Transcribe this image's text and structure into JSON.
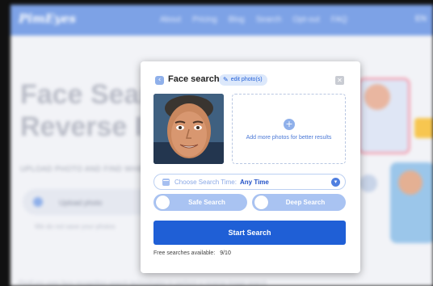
{
  "background": {
    "logo": "PimEyes",
    "nav_links": [
      "About",
      "Pricing",
      "Blog",
      "Search",
      "Opt-out",
      "FAQ"
    ],
    "nav_right": "EN",
    "hero_line1": "Face Search",
    "hero_line2": "Reverse Image",
    "subtitle": "UPLOAD PHOTO AND FIND WHERE IMAGES ARE PUBLISHED",
    "input_text": "Upload photo",
    "note": "We do not save your photos",
    "bottom_text": "PimEyes uses face recognition search technologies to perform a reverse image search"
  },
  "modal": {
    "title": "Face search",
    "edit_chip_label": "edit photo(s)",
    "add_more_text": "Add more photos for better results",
    "time_select": {
      "label": "Choose Search Time:",
      "value": "Any Time"
    },
    "toggles": {
      "safe": {
        "label": "Safe Search",
        "on": false
      },
      "deep": {
        "label": "Deep Search",
        "on": false
      }
    },
    "start_button": "Start Search",
    "free_label": "Free searches available:",
    "free_count": "9/10"
  },
  "colors": {
    "primary": "#1f5fd6",
    "accent_light": "#a9c3f2",
    "nav_blue": "#7da2e6"
  },
  "icons": {
    "back": "arrow-left-icon",
    "edit": "magic-wand-icon",
    "close": "close-icon",
    "add": "plus-icon",
    "calendar": "calendar-icon",
    "chevron": "chevron-down-icon"
  }
}
